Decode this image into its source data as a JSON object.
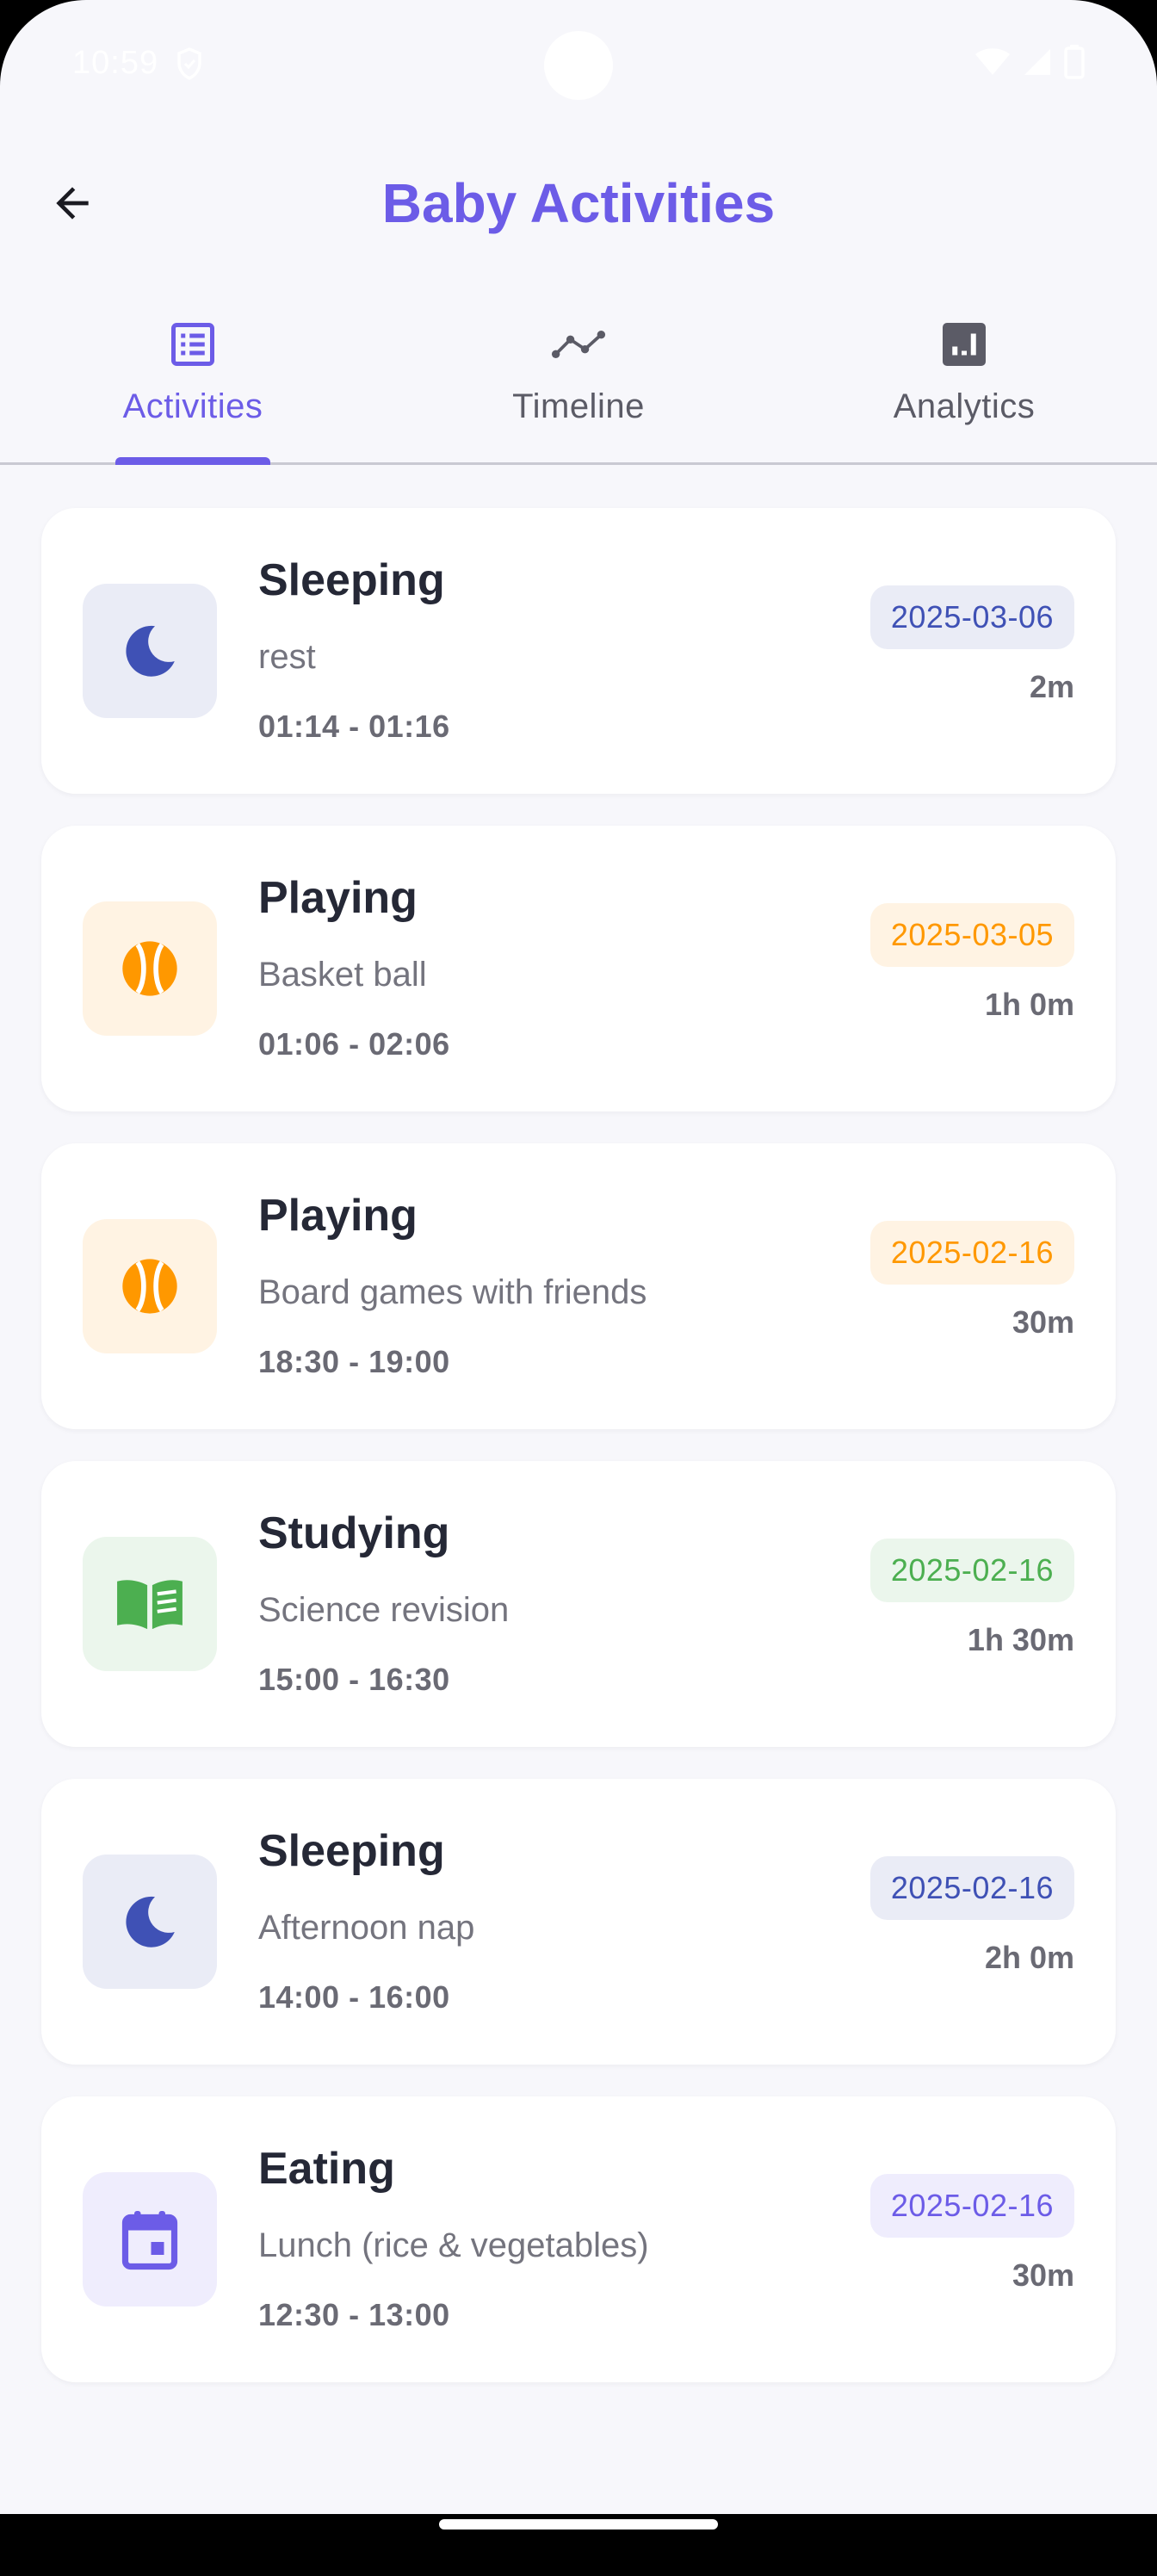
{
  "status_bar": {
    "time": "10:59"
  },
  "app_bar": {
    "title": "Baby Activities"
  },
  "tabs": [
    {
      "label": "Activities",
      "icon": "list-icon",
      "active": true
    },
    {
      "label": "Timeline",
      "icon": "timeline-icon",
      "active": false
    },
    {
      "label": "Analytics",
      "icon": "analytics-icon",
      "active": false
    }
  ],
  "colors": {
    "accent": "#6c5ce7",
    "sleeping": "#3f51b5",
    "playing": "#ff9800",
    "studying": "#4caf50",
    "eating": "#6c5ce7"
  },
  "activities": [
    {
      "title": "Sleeping",
      "note": "rest",
      "time_range": "01:14 - 01:16",
      "date": "2025-03-06",
      "duration": "2m",
      "icon": "moon-icon"
    },
    {
      "title": "Playing",
      "note": "Basket ball",
      "time_range": "01:06 - 02:06",
      "date": "2025-03-05",
      "duration": "1h 0m",
      "icon": "ball-icon"
    },
    {
      "title": "Playing",
      "note": "Board games with friends",
      "time_range": "18:30 - 19:00",
      "date": "2025-02-16",
      "duration": "30m",
      "icon": "ball-icon"
    },
    {
      "title": "Studying",
      "note": "Science revision",
      "time_range": "15:00 - 16:30",
      "date": "2025-02-16",
      "duration": "1h 30m",
      "icon": "book-icon"
    },
    {
      "title": "Sleeping",
      "note": "Afternoon nap",
      "time_range": "14:00 - 16:00",
      "date": "2025-02-16",
      "duration": "2h 0m",
      "icon": "moon-icon"
    },
    {
      "title": "Eating",
      "note": "Lunch (rice & vegetables)",
      "time_range": "12:30 - 13:00",
      "date": "2025-02-16",
      "duration": "30m",
      "icon": "calendar-icon"
    }
  ]
}
